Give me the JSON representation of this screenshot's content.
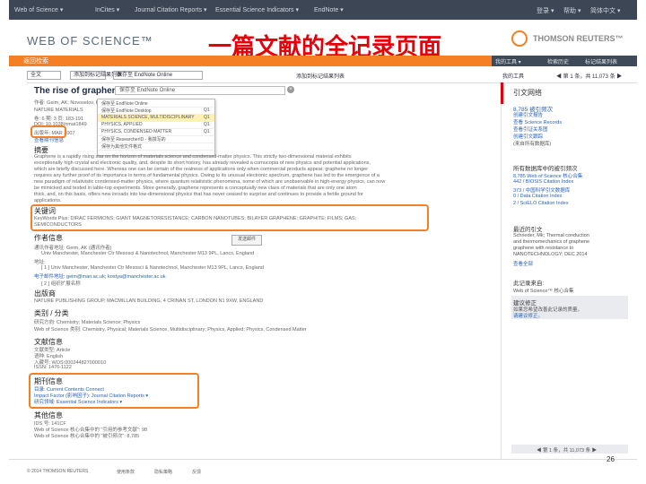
{
  "slide_title": "一篇文献的全记录页面",
  "topbar": {
    "left": "Web of Science ▾",
    "items": [
      "InCites ▾",
      "Journal Citation Reports ▾",
      "Essential Science Indicators ▾",
      "EndNote ▾"
    ],
    "right": [
      "登录 ▾",
      "帮助 ▾",
      "简体中文 ▾"
    ]
  },
  "header": {
    "logo": "WEB OF SCIENCE™",
    "brand": "THOMSON REUTERS™"
  },
  "nav": {
    "back": "返回检索",
    "right": [
      "我的工具 ▾",
      "检索历史",
      "标记结果列表"
    ]
  },
  "toolbar": {
    "full_text": "全文",
    "save_box": "保存至 EndNote Online",
    "add_to_marked": "添加到标记结果列表",
    "pager": "◀ 第 1 条，共 11,073 条 ▶",
    "my_tools": "我的工具"
  },
  "article": {
    "title": "The rise of graphene",
    "dropdown_rows": [
      "保存至 EndNote Online",
      "保存至 EndNote Desktop",
      "保存至 ResearcherID - 我撰写的",
      "保存为其他文件格式",
      "MATERIALS SCIENCE, MULTIDISCIPLINARY",
      "PHYSICS, APPLIED",
      "PHYSICS, CONDENSED MATTER"
    ],
    "dropdown_codes": [
      "Q1",
      "Q1",
      "Q1",
      "Q1"
    ],
    "journal_lines": [
      "作者: Geim, AK; Novoselov, KS",
      "NATURE MATERIALS",
      "卷: 6  期: 3  页: 183-191",
      "DOI: 10.1038/nmat1849",
      "出版年: MAR 2007",
      "查看期刊信息"
    ],
    "abstract_label": "摘要",
    "abstract_lines": [
      "Graphene is a rapidly rising star on the horizon of materials science and condensed-matter physics. This strictly two-dimensional material exhibits",
      "exceptionally high crystal and electronic quality, and, despite its short history, has already revealed a cornucopia of new physics and potential applications,",
      "which are briefly discussed here. Whereas one can be certain of the realness of applications only when commercial products appear, graphene no longer",
      "requires any further proof of its importance in terms of fundamental physics. Owing to its unusual electronic spectrum, graphene has led to the emergence of a",
      "new paradigm of relativistic condensed-matter physics, where quantum relativistic phenomena, some of which are unobservable in high-energy physics, can now",
      "be mimicked and tested in table-top experiments. More generally, graphene represents a conceptually new class of materials that are only one atom",
      "thick, and, on this basis, offers new inroads into low-dimensional physics that has never ceased to surprise and continues to provide a fertile ground for",
      "applications."
    ],
    "keywords_label": "关键词",
    "keywords_line1": "KeyWords Plus: DIRAC FERMIONS; GIANT MAGNETORESISTANCE; CARBON NANOTUBES; BILAYER GRAPHENE; GRAPHITE; FILMS; GAS;",
    "keywords_line2": "SEMICONDUCTORS",
    "author_info_label": "作者信息",
    "author_lines": [
      "通讯作者地址: Geim, AK (通讯作者)",
      "Univ Manchester, Manchester Ctr Mesosci & Nanotechnol, Manchester M13 9PL, Lancs, England",
      "地址:",
      "[ 1 ] Univ Manchester, Manchester Ctr Mesosci & Nanotechnol, Manchester M13 9PL, Lancs, England",
      "电子邮件地址: geim@man.ac.uk; kostya@manchester.ac.uk",
      "[ 2 ] 组织扩展名称"
    ],
    "publisher_label": "出版商",
    "publisher_line": "NATURE PUBLISHING GROUP, MACMILLAN BUILDING, 4 CRINAN ST, LONDON N1 9XW, ENGLAND",
    "category_label": "类别 / 分类",
    "category_lines": [
      "研究方向: Chemistry; Materials Science; Physics",
      "Web of Science 类别: Chemistry, Physical; Materials Science, Multidisciplinary; Physics, Applied; Physics, Condensed Matter"
    ],
    "doc_info_label": "文献信息",
    "doc_info_lines": [
      "文献类型: Article",
      "语种: English",
      "入藏号: WOS:000244827000010",
      "ISSN: 1476-1122"
    ],
    "journal_info_label": "期刊信息",
    "journal_info_lines": [
      "目录: Current Contents Connect",
      "Impact Factor (影响因子): Journal Citation Reports ▾",
      "研究领域: Essential Science Indicators ▾"
    ],
    "other_label": "其他信息",
    "other_lines": [
      "IDS 号: 141CF",
      "Web of Science 核心合集中的 \"引用的参考文献\": 98",
      "Web of Science 核心合集中的 \"被引频次\": 8,785"
    ],
    "send_button": "发送邮件"
  },
  "sidebar": {
    "title": "引文网络",
    "cited_count": "8,785 被引频次",
    "lines": [
      "8,785 被引频次",
      "创建引文报告",
      "查看 Science Records",
      "查看引证关系图",
      "创建引文跟踪"
    ],
    "all_db_note": "(来自所有数据库)",
    "section2": "所有数据库中的被引频次",
    "section2_lines": [
      "8,785 Web of Science 核心合集",
      "442 / BIOSIS Citation Index",
      "373 / 中国科学引文数据库",
      "0 / Data Citation Index",
      "2 / SciELO Citation Index"
    ],
    "section3": "最近的引文",
    "section3_lines": [
      "Schrieder, Mk; Thermal conduction",
      "and thermomechanics of graphene",
      "graphene with resistance to",
      "NANOTECHNOLOGY; DEC 2014"
    ],
    "view_all": "查看全部",
    "section4": "此记录来自:",
    "section4_line": "Web of Science™ 核心合集",
    "section5": "建议修正",
    "section5_lines": [
      "如果您希望改善此记录的质量，",
      "请建议修正。"
    ],
    "pager": "◀ 第 1 条，共 11,073 条 ▶"
  },
  "footer": {
    "copyright": "© 2014 THOMSON REUTERS",
    "links": [
      "使用条款",
      "隐私策略",
      "反馈"
    ]
  },
  "page_number": "26"
}
